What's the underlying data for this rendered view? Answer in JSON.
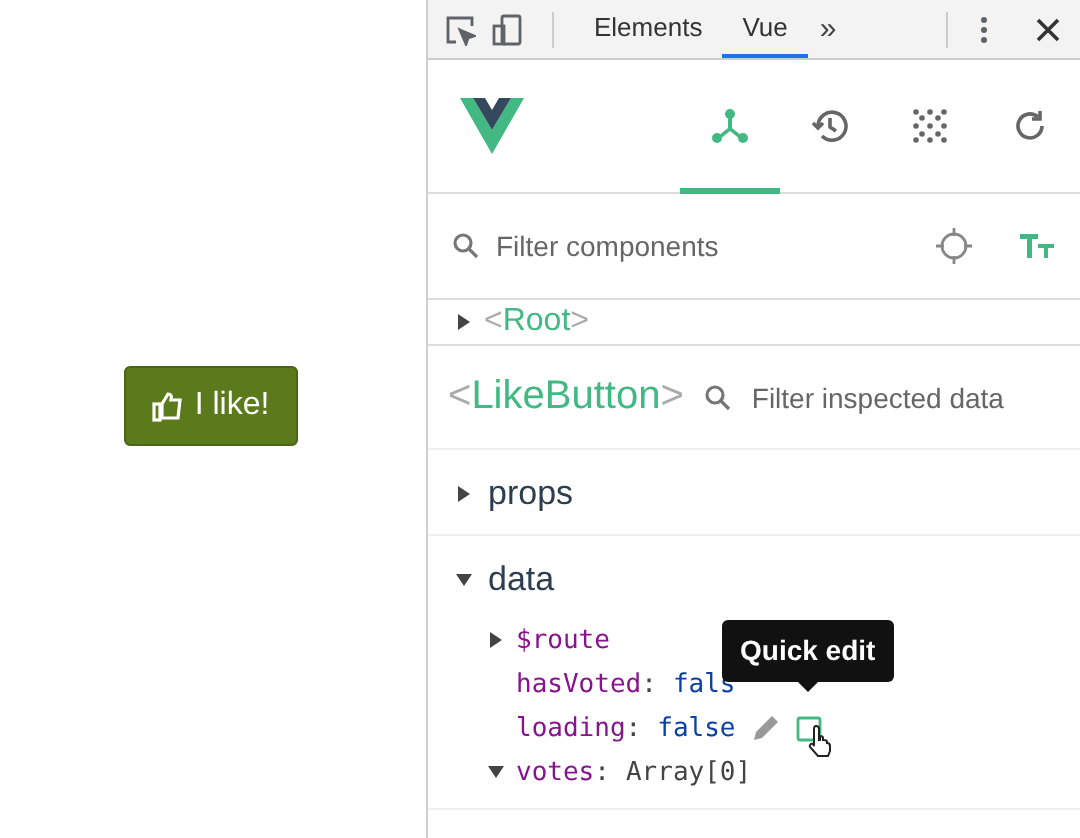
{
  "page": {
    "like_button": {
      "label": "I like!"
    }
  },
  "devtools": {
    "tabs": [
      {
        "label": "Elements",
        "selected": false
      },
      {
        "label": "Vue",
        "selected": true
      }
    ],
    "more": "»"
  },
  "vue": {
    "toolbar": [
      {
        "kind": "components",
        "selected": true
      },
      {
        "kind": "history",
        "selected": false
      },
      {
        "kind": "vuex",
        "selected": false
      },
      {
        "kind": "refresh",
        "selected": false
      }
    ],
    "filter": {
      "placeholder": "Filter components"
    },
    "tree": [
      {
        "open": "<",
        "name": "Root",
        "close": ">",
        "expanded": false
      }
    ],
    "inspector": {
      "open": "<",
      "name": "LikeButton",
      "close": ">",
      "filter": {
        "placeholder": "Filter inspected data"
      },
      "sections": [
        {
          "title": "props",
          "expanded": false
        },
        {
          "title": "data",
          "expanded": true,
          "entries": [
            {
              "kind": "object",
              "key": "$route",
              "expanded": false
            },
            {
              "kind": "value",
              "key": "hasVoted",
              "colon": ":",
              "value": "fals"
            },
            {
              "kind": "value",
              "key": "loading",
              "colon": ":",
              "value": "false",
              "editing": true
            },
            {
              "kind": "array",
              "key": "votes",
              "colon": ":",
              "value": "Array[0]",
              "expanded": true
            }
          ]
        }
      ]
    },
    "tooltip": "Quick edit"
  }
}
